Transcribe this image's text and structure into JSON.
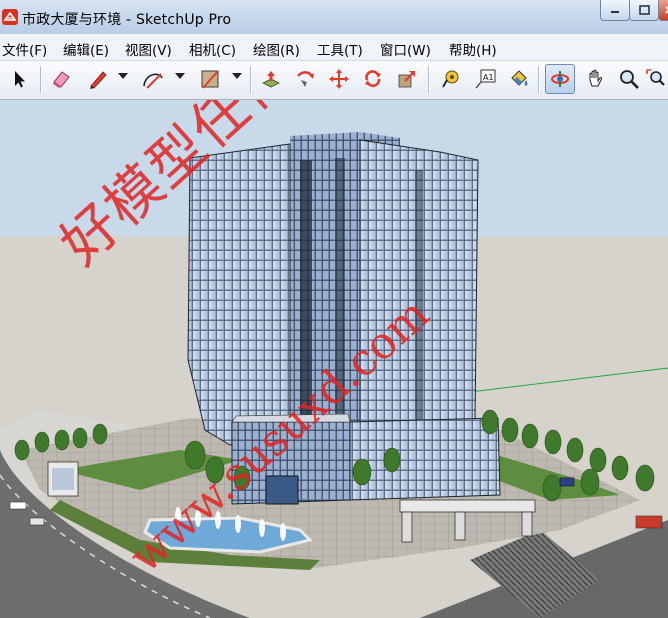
{
  "window": {
    "title": "市政大厦与环境 - SketchUp Pro",
    "app_icon": "sketchup-logo-icon"
  },
  "menu": [
    {
      "label": "文件(F)"
    },
    {
      "label": "编辑(E)"
    },
    {
      "label": "视图(V)"
    },
    {
      "label": "相机(C)"
    },
    {
      "label": "绘图(R)"
    },
    {
      "label": "工具(T)"
    },
    {
      "label": "窗口(W)"
    },
    {
      "label": "帮助(H)"
    }
  ],
  "toolbar": {
    "tools": [
      {
        "name": "select-tool",
        "icon": "arrow-icon"
      },
      {
        "name": "eraser-tool",
        "icon": "eraser-icon"
      },
      {
        "name": "line-tool",
        "icon": "pencil-icon"
      },
      {
        "name": "arc-tool",
        "icon": "arc-icon"
      },
      {
        "name": "rectangle-tool",
        "icon": "rectangle-icon"
      },
      {
        "name": "push-pull-tool",
        "icon": "push-pull-icon"
      },
      {
        "name": "follow-me-tool",
        "icon": "follow-me-icon"
      },
      {
        "name": "move-tool",
        "icon": "move-icon"
      },
      {
        "name": "rotate-tool",
        "icon": "rotate-icon"
      },
      {
        "name": "scale-tool",
        "icon": "scale-icon"
      },
      {
        "name": "tape-measure-tool",
        "icon": "tape-measure-icon"
      },
      {
        "name": "text-tool",
        "icon": "text-label-icon",
        "label": "A1"
      },
      {
        "name": "paint-bucket-tool",
        "icon": "paint-bucket-icon"
      },
      {
        "name": "orbit-tool",
        "icon": "orbit-icon",
        "active": true
      },
      {
        "name": "pan-tool",
        "icon": "hand-icon"
      },
      {
        "name": "zoom-tool",
        "icon": "magnifier-icon"
      },
      {
        "name": "zoom-extents-tool",
        "icon": "zoom-extents-icon"
      }
    ]
  },
  "viewport": {
    "description_icon": "3d-model-viewport",
    "sky_color": "#c8d9ea",
    "ground_color": "#d6d3cc",
    "watermark_text": "好模型任你下",
    "watermark_url": "www.susuxd.com",
    "watermark_color": "#e02020"
  }
}
